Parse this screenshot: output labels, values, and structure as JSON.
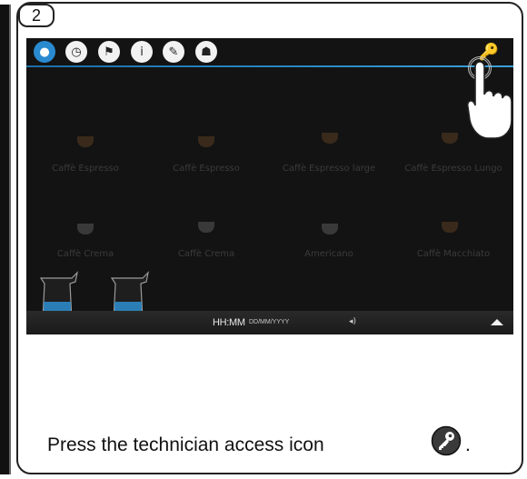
{
  "step": "2",
  "topbar": {
    "icons": [
      {
        "name": "water-drop-icon",
        "glyph": "●",
        "active": true
      },
      {
        "name": "clock-icon",
        "glyph": "◷",
        "active": false
      },
      {
        "name": "flag-icon",
        "glyph": "⚑",
        "active": false
      },
      {
        "name": "info-icon",
        "glyph": "i",
        "active": false
      },
      {
        "name": "pencil-icon",
        "glyph": "✎",
        "active": false
      },
      {
        "name": "person-icon",
        "glyph": "☗",
        "active": false
      }
    ],
    "key_glyph": "🔑"
  },
  "drinks": [
    "Caffè Espresso",
    "Caffè Espresso",
    "Caffè Espresso large",
    "Caffè Espresso Lungo",
    "Caffè Crema",
    "Caffè Crema",
    "Americano",
    "Caffè Macchiato"
  ],
  "statusbar": {
    "time": "HH:MM",
    "date": "DD/MM/YYYY",
    "volume_glyph": "◂)"
  },
  "caption": {
    "text": "Press the technician access icon",
    "end": "."
  },
  "colors": {
    "accent": "#2a8ad0",
    "screen_bg": "#131313"
  }
}
